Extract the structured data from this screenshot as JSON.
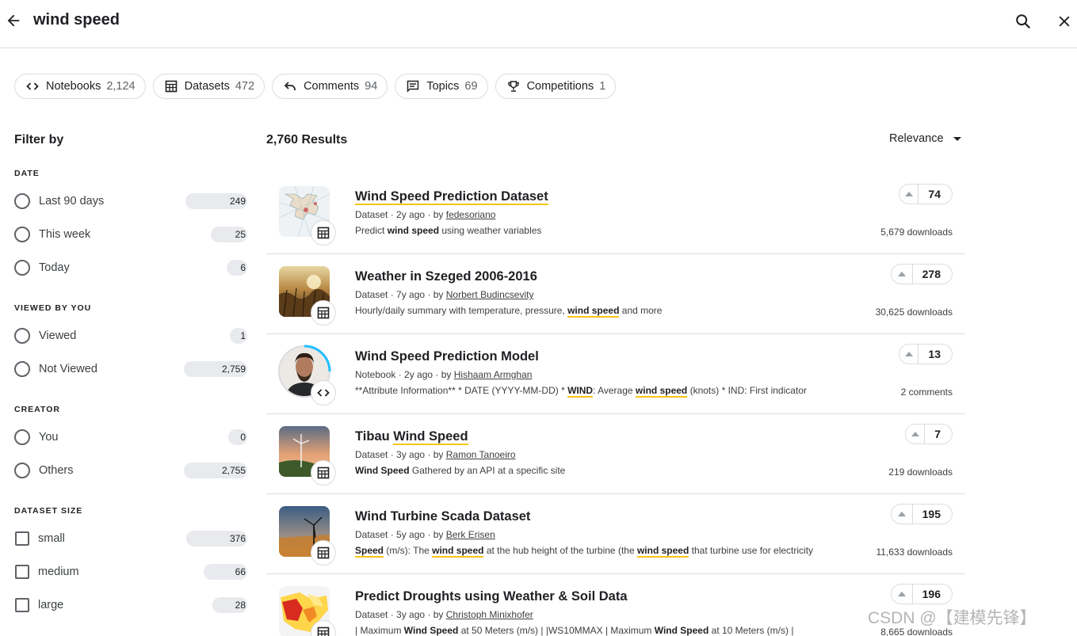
{
  "search": {
    "query": "wind speed"
  },
  "chips": [
    {
      "label": "Notebooks",
      "count": "2,124",
      "icon": "code-icon"
    },
    {
      "label": "Datasets",
      "count": "472",
      "icon": "table-icon"
    },
    {
      "label": "Comments",
      "count": "94",
      "icon": "reply-icon"
    },
    {
      "label": "Topics",
      "count": "69",
      "icon": "chat-icon"
    },
    {
      "label": "Competitions",
      "count": "1",
      "icon": "trophy-icon"
    }
  ],
  "sidebar": {
    "title": "Filter by",
    "groups": [
      {
        "label": "DATE",
        "options": [
          {
            "label": "Last 90 days",
            "count": "249"
          },
          {
            "label": "This week",
            "count": "25"
          },
          {
            "label": "Today",
            "count": "6"
          }
        ]
      },
      {
        "label": "VIEWED BY YOU",
        "options": [
          {
            "label": "Viewed",
            "count": "1"
          },
          {
            "label": "Not Viewed",
            "count": "2,759"
          }
        ]
      },
      {
        "label": "CREATOR",
        "options": [
          {
            "label": "You",
            "count": "0"
          },
          {
            "label": "Others",
            "count": "2,755"
          }
        ]
      },
      {
        "label": "DATASET SIZE",
        "options": [
          {
            "label": "small",
            "count": "376"
          },
          {
            "label": "medium",
            "count": "66"
          },
          {
            "label": "large",
            "count": "28"
          }
        ]
      }
    ]
  },
  "results": {
    "count_label": "2,760 Results",
    "sort_label": "Relevance",
    "items": [
      {
        "title_pre": "",
        "title_hl": "Wind Speed Prediction Dataset",
        "title_post": "",
        "type": "Dataset",
        "age": "2y ago",
        "author": "fedesoriano",
        "desc": [
          {
            "t": "Predict "
          },
          {
            "t": "wind speed",
            "b": 1
          },
          {
            "t": " using weather variables"
          }
        ],
        "votes": "74",
        "stat": "5,679 downloads",
        "kind": "dataset"
      },
      {
        "title_pre": "Weather in Szeged 2006-2016",
        "title_hl": "",
        "title_post": "",
        "type": "Dataset",
        "age": "7y ago",
        "author": "Norbert Budincsevity",
        "desc": [
          {
            "t": "Hourly/daily summary with temperature, pressure, "
          },
          {
            "t": "wind speed",
            "h": 1
          },
          {
            "t": " and more"
          }
        ],
        "votes": "278",
        "stat": "30,625 downloads",
        "kind": "dataset"
      },
      {
        "title_pre": "Wind Speed Prediction Model",
        "title_hl": "",
        "title_post": "",
        "type": "Notebook",
        "age": "2y ago",
        "author": "Hishaam Armghan",
        "desc": [
          {
            "t": "**Attribute Information** * DATE (YYYY-MM-DD) * "
          },
          {
            "t": "WIND",
            "h": 1
          },
          {
            "t": ": Average "
          },
          {
            "t": "wind speed",
            "h": 1
          },
          {
            "t": " (knots) * IND: First indicator"
          }
        ],
        "votes": "13",
        "stat": "2 comments",
        "kind": "notebook"
      },
      {
        "title_pre": "Tibau ",
        "title_hl": "Wind Speed",
        "title_post": "",
        "type": "Dataset",
        "age": "3y ago",
        "author": "Ramon Tanoeiro",
        "desc": [
          {
            "t": "Wind Speed",
            "b": 1
          },
          {
            "t": " Gathered by an API at a specific site"
          }
        ],
        "votes": "7",
        "stat": "219 downloads",
        "kind": "dataset"
      },
      {
        "title_pre": "Wind Turbine Scada Dataset",
        "title_hl": "",
        "title_post": "",
        "type": "Dataset",
        "age": "5y ago",
        "author": "Berk Erisen",
        "desc": [
          {
            "t": "Speed",
            "h": 1
          },
          {
            "t": " (m/s): The "
          },
          {
            "t": "wind speed",
            "h": 1
          },
          {
            "t": " at the hub height of the turbine (the "
          },
          {
            "t": "wind speed",
            "h": 1
          },
          {
            "t": " that turbine use for electricity"
          }
        ],
        "votes": "195",
        "stat": "11,633 downloads",
        "kind": "dataset"
      },
      {
        "title_pre": "Predict Droughts using Weather & Soil Data",
        "title_hl": "",
        "title_post": "",
        "type": "Dataset",
        "age": "3y ago",
        "author": "Christoph Minixhofer",
        "desc": [
          {
            "t": "| Maximum "
          },
          {
            "t": "Wind Speed",
            "h": 1
          },
          {
            "t": " at 50 Meters (m/s) | |WS10MMAX | Maximum "
          },
          {
            "t": "Wind Speed",
            "h": 1
          },
          {
            "t": " at 10 Meters (m/s) |"
          }
        ],
        "votes": "196",
        "stat": "8,665 downloads",
        "kind": "dataset"
      }
    ]
  },
  "watermark": "CSDN @【建模先锋】"
}
